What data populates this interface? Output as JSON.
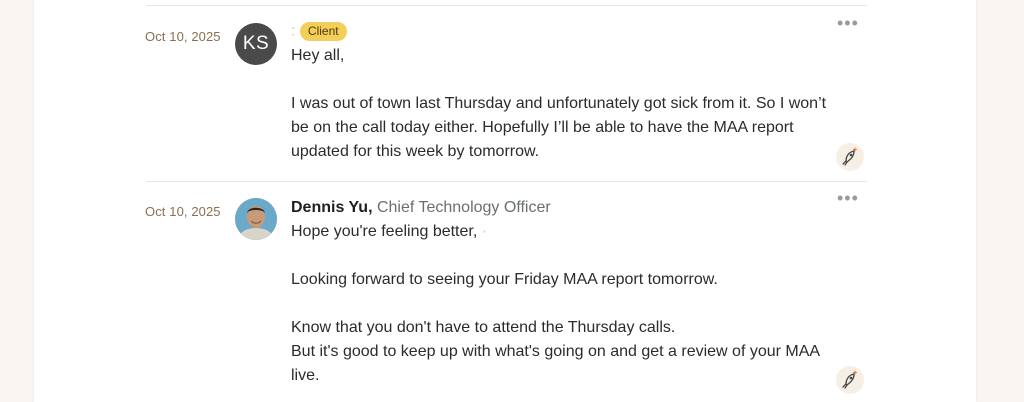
{
  "posts": [
    {
      "date": "Oct 10, 2025",
      "avatar_initials": "KS",
      "author": "",
      "role_badge": "Client",
      "more_label": "•••",
      "paragraphs": [
        "Hey all,",
        "",
        "I was out of town last Thursday and unfortunately got sick from it. So I won’t be on the call today either. Hopefully I’ll be able to have the MAA report updated for this week by tomorrow."
      ],
      "boost_icon": "rocket-icon"
    },
    {
      "date": "Oct 10, 2025",
      "avatar_icon": "person-photo",
      "author": "Dennis Yu,",
      "role": "Chief Technology Officer",
      "more_label": "•••",
      "paragraphs": [
        "Hope you're feeling better,",
        "",
        "Looking forward to seeing your Friday MAA report tomorrow.",
        "",
        "Know that you don't have to attend the Thursday calls.",
        "But it's good to keep up with what's going on and get a review of your MAA live."
      ],
      "boost_icon": "rocket-icon"
    }
  ],
  "colors": {
    "page_bg": "#f9f6f1",
    "date": "#8a6f52",
    "badge": "#f3cf5a",
    "role": "#6a6f73"
  }
}
